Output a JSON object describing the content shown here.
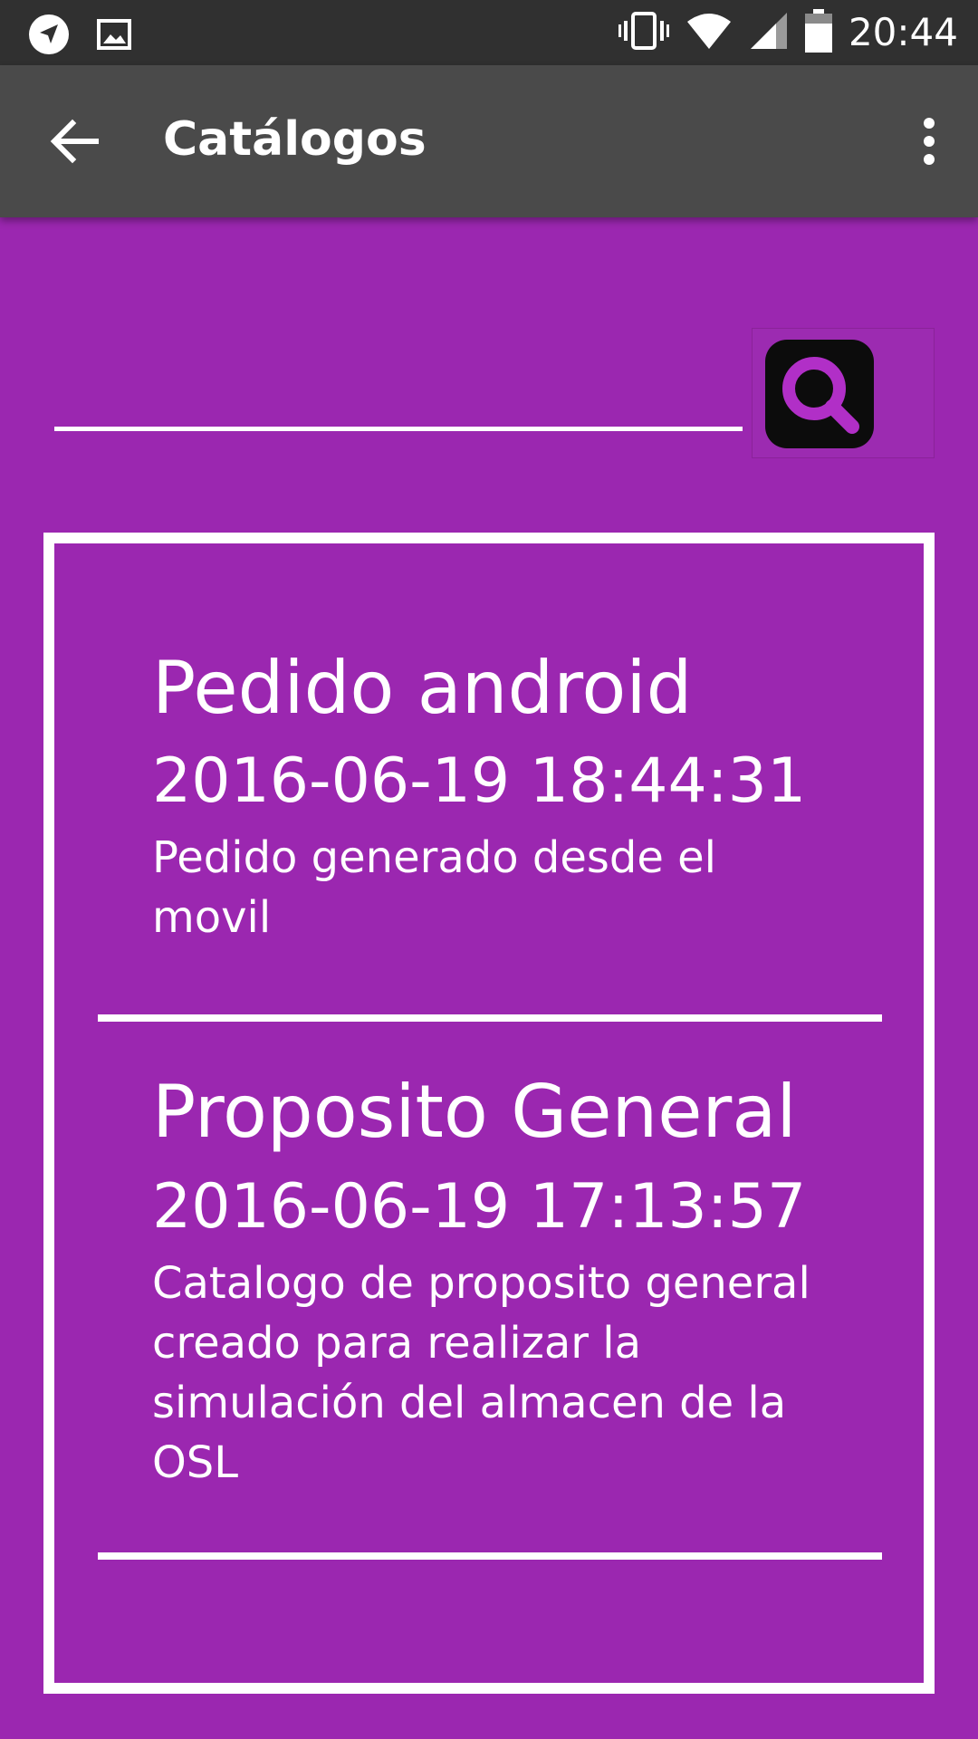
{
  "status_bar": {
    "time": "20:44",
    "icons": [
      "navigation-icon",
      "image-icon",
      "vibrate-icon",
      "wifi-icon",
      "signal-icon",
      "battery-icon"
    ]
  },
  "app_bar": {
    "title": "Catálogos",
    "back_icon": "arrow-back-icon",
    "overflow_icon": "more-vert-icon"
  },
  "search": {
    "value": "",
    "button_icon": "magnifier-icon"
  },
  "catalogs": [
    {
      "title": "Pedido android",
      "date": "2016-06-19 18:44:31",
      "description": "Pedido generado desde el movil"
    },
    {
      "title": "Proposito General",
      "date": "2016-06-19 17:13:57",
      "description": "Catalogo de proposito general creado para realizar la simulación del almacen de la OSL"
    }
  ],
  "colors": {
    "background": "#9b27b0",
    "app_bar": "#4a4a4a",
    "status_bar": "#303030",
    "text": "#ffffff"
  }
}
